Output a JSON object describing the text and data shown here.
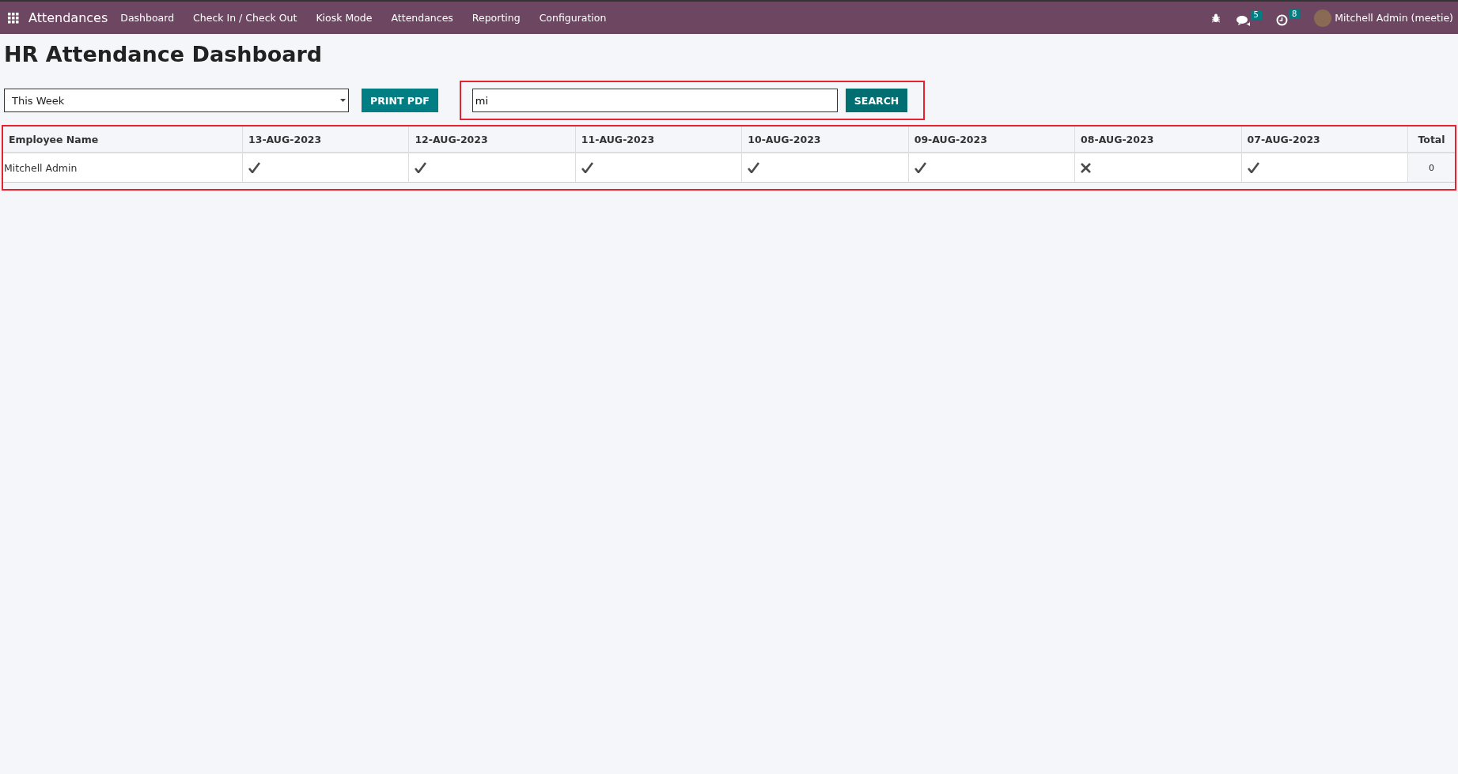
{
  "navbar": {
    "app_name": "Attendances",
    "menu": [
      {
        "label": "Dashboard"
      },
      {
        "label": "Check In / Check Out"
      },
      {
        "label": "Kiosk Mode"
      },
      {
        "label": "Attendances"
      },
      {
        "label": "Reporting"
      },
      {
        "label": "Configuration"
      }
    ],
    "messages_count": "5",
    "activities_count": "8",
    "user": "Mitchell Admin (meetie)"
  },
  "title": "HR Attendance Dashboard",
  "filters": {
    "period": "This Week",
    "print_button": "PRINT PDF",
    "search_value": "mi",
    "search_button": "SEARCH",
    "highlighted": true
  },
  "table": {
    "highlighted": true,
    "columns": [
      "Employee Name",
      "13-AUG-2023",
      "12-AUG-2023",
      "11-AUG-2023",
      "10-AUG-2023",
      "09-AUG-2023",
      "08-AUG-2023",
      "07-AUG-2023",
      "Total"
    ],
    "rows": [
      {
        "employee": "Mitchell Admin",
        "days": [
          {
            "present": true
          },
          {
            "present": true
          },
          {
            "present": true
          },
          {
            "present": true
          },
          {
            "present": true
          },
          {
            "present": false
          },
          {
            "present": true
          }
        ],
        "total": "0"
      }
    ]
  }
}
